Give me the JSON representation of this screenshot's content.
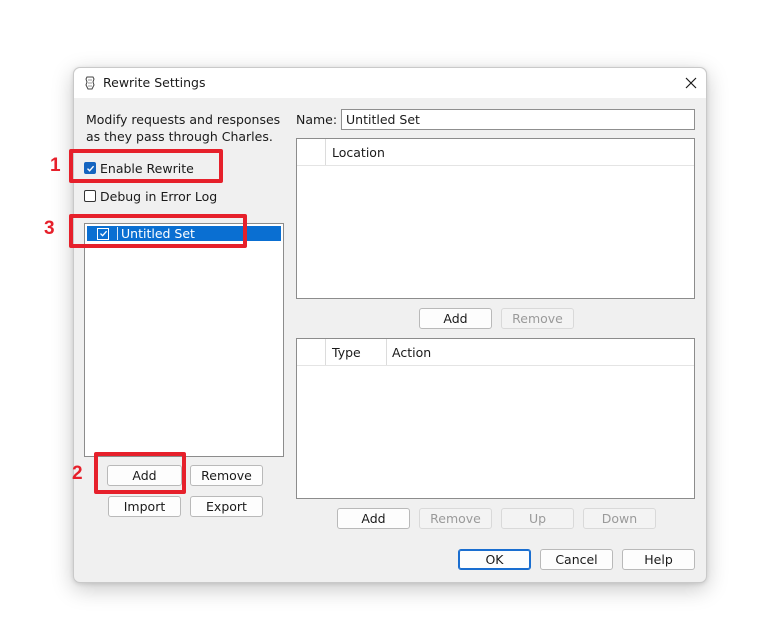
{
  "window": {
    "title": "Rewrite Settings"
  },
  "left": {
    "description_line1": "Modify requests and responses",
    "description_line2": "as they pass through Charles.",
    "enable_rewrite": {
      "label": "Enable Rewrite",
      "checked": true
    },
    "debug_log": {
      "label": "Debug in Error Log",
      "checked": false
    },
    "sets": [
      {
        "label": "Untitled Set",
        "checked": true,
        "selected": true
      }
    ],
    "buttons": {
      "add": "Add",
      "remove": "Remove",
      "import": "Import",
      "export": "Export"
    }
  },
  "right": {
    "name_label": "Name:",
    "name_value": "Untitled Set",
    "locations": {
      "columns": [
        "",
        "Location"
      ],
      "rows": [],
      "add": "Add",
      "remove": "Remove"
    },
    "rules": {
      "columns": [
        "",
        "Type",
        "Action"
      ],
      "rows": [],
      "add": "Add",
      "remove": "Remove",
      "up": "Up",
      "down": "Down"
    }
  },
  "footer": {
    "ok": "OK",
    "cancel": "Cancel",
    "help": "Help"
  },
  "annotations": {
    "label_1": "1",
    "label_2": "2",
    "label_3": "3",
    "color": "#e6202b"
  },
  "colors": {
    "selection": "#0a6fd2",
    "checkbox_checked": "#1565c0",
    "default_button_border": "#1a6ed0"
  }
}
